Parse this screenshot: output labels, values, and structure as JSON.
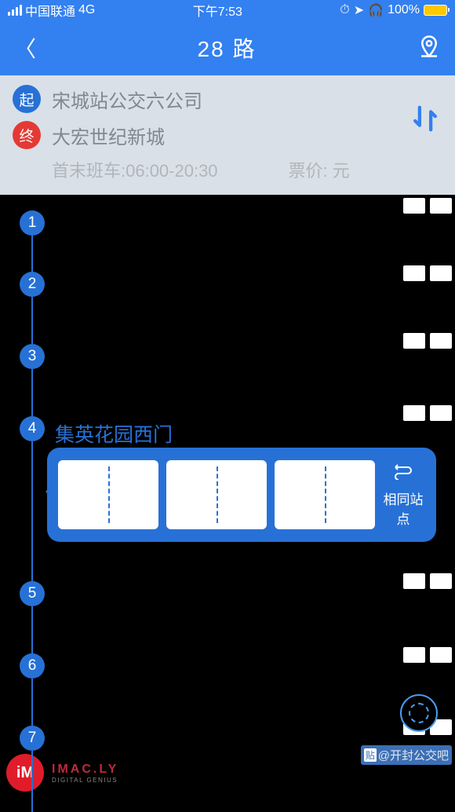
{
  "status": {
    "carrier": "中国联通",
    "network": "4G",
    "time": "下午7:53",
    "battery_pct": "100%"
  },
  "nav": {
    "title": "28 路"
  },
  "route": {
    "start_badge": "起",
    "start_name": "宋城站公交六公司",
    "end_badge": "终",
    "end_name": "大宏世纪新城",
    "schedule": "首末班车:06:00-20:30",
    "fare_label": "票价: 元"
  },
  "stops": [
    {
      "num": "1",
      "name": ""
    },
    {
      "num": "2",
      "name": ""
    },
    {
      "num": "3",
      "name": ""
    },
    {
      "num": "4",
      "name": "集英花园西门",
      "highlight": true
    },
    {
      "num": "5",
      "name": ""
    },
    {
      "num": "6",
      "name": ""
    },
    {
      "num": "7",
      "name": ""
    }
  ],
  "bubble": {
    "same_stop_label": "相同站点"
  },
  "watermark": {
    "badge": "iM",
    "text": "IMAC.LY",
    "sub": "DIGITAL GENIUS"
  },
  "post_tag": "@开封公交吧"
}
